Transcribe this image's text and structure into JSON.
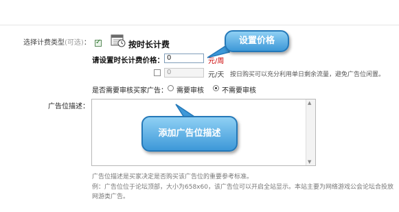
{
  "billing": {
    "label": "选择计费类型",
    "optional": "(可选)",
    "colon": "：",
    "option_title": "按时长计费"
  },
  "price": {
    "label": "请设置时长计费价格：",
    "week_value": "0",
    "week_unit": "元/周",
    "day_value": "0",
    "day_unit": "元/天",
    "day_note": "按日购买可以充分利用单日剩余流量，避免广告位闲置。"
  },
  "review": {
    "label": "是否需要审核买家广告：",
    "options": [
      "需要审核",
      "不需要审核"
    ],
    "selected_index": 1
  },
  "description": {
    "label": "广告位描述：",
    "note1": "广告位描述是买家决定是否购买该广告位的重要参考标准。",
    "note2": "例：广告位位于论坛顶部，大小为658x60，该广告位可以开启全站显示。本站主要为网络游戏公会论坛合投放网游类广告。"
  },
  "callouts": {
    "set_price": "设置价格",
    "add_description": "添加广告位描述"
  },
  "colors": {
    "callout_fill": "#3d98d8",
    "callout_border": "#2478b8",
    "unit_red": "#cc0000"
  }
}
